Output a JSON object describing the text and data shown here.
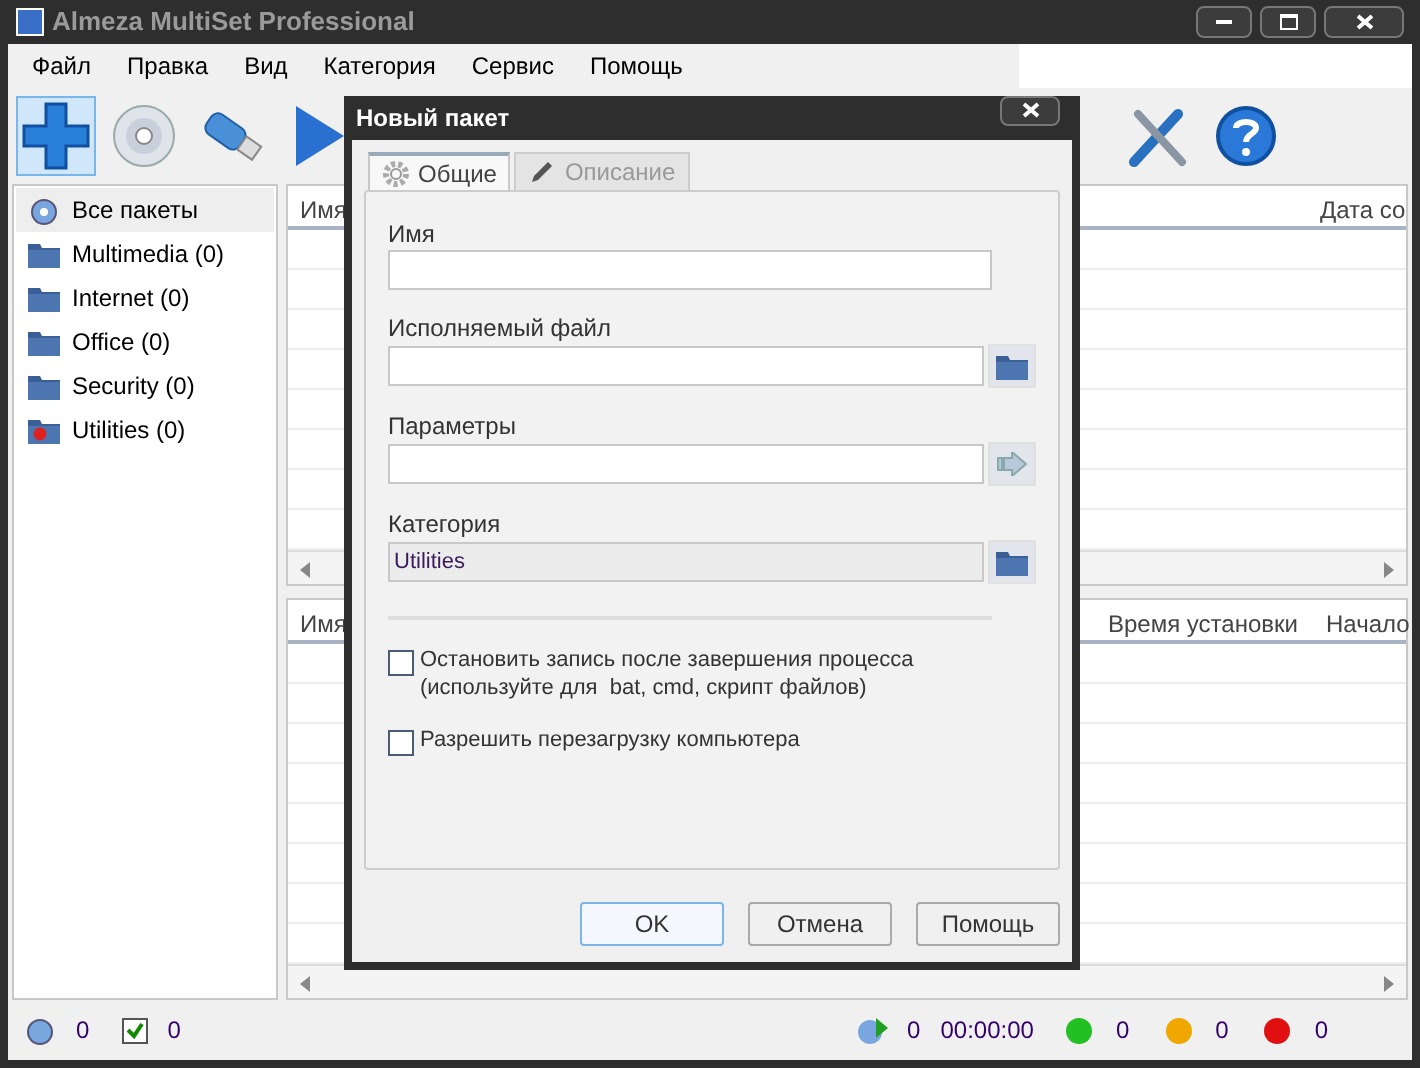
{
  "window": {
    "title": "Almeza MultiSet Professional"
  },
  "menu": [
    "Файл",
    "Правка",
    "Вид",
    "Категория",
    "Сервис",
    "Помощь"
  ],
  "toolbar": [
    {
      "kind": "add",
      "selected": true
    },
    {
      "kind": "disc",
      "selected": false
    },
    {
      "kind": "usb",
      "selected": false
    },
    {
      "kind": "play",
      "selected": false
    },
    {
      "kind": "tools",
      "selected": false
    },
    {
      "kind": "help",
      "selected": false
    }
  ],
  "sidebar": {
    "items": [
      {
        "label": "Все пакеты",
        "kind": "all",
        "selected": true
      },
      {
        "label": "Multimedia (0)",
        "kind": "folder",
        "selected": false
      },
      {
        "label": "Internet (0)",
        "kind": "folder",
        "selected": false
      },
      {
        "label": "Office (0)",
        "kind": "folder",
        "selected": false
      },
      {
        "label": "Security (0)",
        "kind": "folder",
        "selected": false
      },
      {
        "label": "Utilities (0)",
        "kind": "folder-red",
        "selected": false
      }
    ]
  },
  "upper_table": {
    "columns": [
      "Имя",
      "Дата со"
    ]
  },
  "lower_table": {
    "columns": [
      "Имя",
      "Время установки",
      "Начало"
    ]
  },
  "dialog": {
    "title": "Новый пакет",
    "tabs": [
      {
        "label": "Общие",
        "selected": true
      },
      {
        "label": "Описание",
        "selected": false
      }
    ],
    "fields": [
      {
        "label": "Имя",
        "kind": "plain"
      },
      {
        "label": "Исполняемый файл",
        "kind": "browse"
      },
      {
        "label": "Параметры",
        "kind": "arrow"
      },
      {
        "label": "Категория",
        "kind": "browse-readonly",
        "value": "Utilities"
      }
    ],
    "checkboxes": [
      {
        "label": "Остановить запись после завершения процесса\n(используйте для  bat, cmd, скрипт файлов)",
        "checked": false
      },
      {
        "label": "Разрешить перезагрузку компьютера",
        "checked": false
      }
    ],
    "buttons": [
      {
        "label": "OK",
        "default": true
      },
      {
        "label": "Отмена",
        "default": false
      },
      {
        "label": "Помощь",
        "default": false
      }
    ]
  },
  "status_bar": {
    "left": [
      {
        "kind": "packages",
        "value": "0"
      },
      {
        "kind": "checked",
        "value": "0"
      }
    ],
    "running": "0",
    "time": "00:00:00",
    "counters": [
      {
        "color": "#22c020",
        "value": "0"
      },
      {
        "color": "#f0a800",
        "value": "0"
      },
      {
        "color": "#e01010",
        "value": "0"
      }
    ]
  }
}
